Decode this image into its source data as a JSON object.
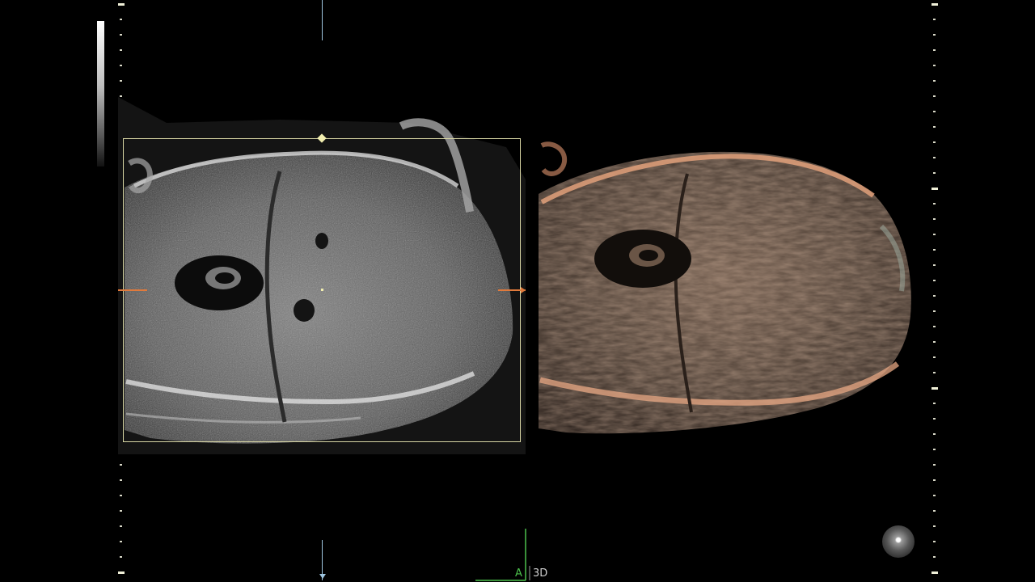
{
  "view": {
    "background_color": "#000000",
    "roi_color": "#d8d6a4",
    "marker_color": "#9fc6e0",
    "cursor_line_color": "#e07a3c",
    "render_tint": "#c9906a"
  },
  "orientation": {
    "axis_label": "A",
    "mode_label": "3D",
    "axis_color": "#4cc04c",
    "mode_color": "#cfcfcf"
  },
  "controls": {
    "light_source_icon": "light-source-icon"
  }
}
